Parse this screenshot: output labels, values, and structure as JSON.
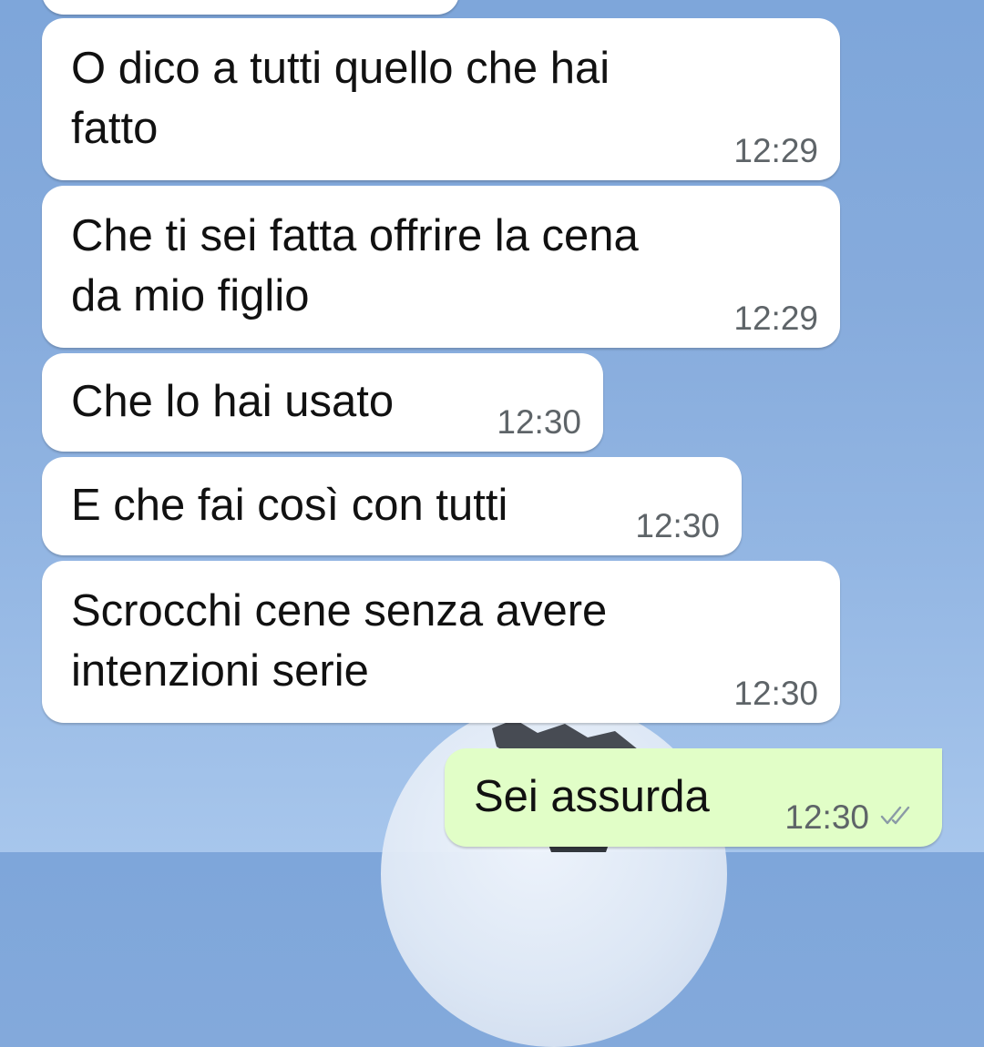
{
  "colors": {
    "incoming_bubble": "#ffffff",
    "outgoing_bubble": "#e1fec7",
    "timestamp": "#5e6468",
    "read_tick": "#8a9aa6"
  },
  "messages": [
    {
      "text": "",
      "time": "",
      "direction": "incoming"
    },
    {
      "text": "O dico a tutti quello che hai\nfatto",
      "time": "12:29",
      "direction": "incoming"
    },
    {
      "text": "Che ti sei fatta offrire la cena\nda mio figlio",
      "time": "12:29",
      "direction": "incoming"
    },
    {
      "text": "Che lo hai usato",
      "time": "12:30",
      "direction": "incoming"
    },
    {
      "text": "E che fai così con tutti",
      "time": "12:30",
      "direction": "incoming"
    },
    {
      "text": "Scrocchi cene senza avere\nintenzioni serie",
      "time": "12:30",
      "direction": "incoming"
    },
    {
      "text": "Sei assurda",
      "time": "12:30",
      "direction": "outgoing",
      "status_icon": "double-check-icon"
    }
  ]
}
